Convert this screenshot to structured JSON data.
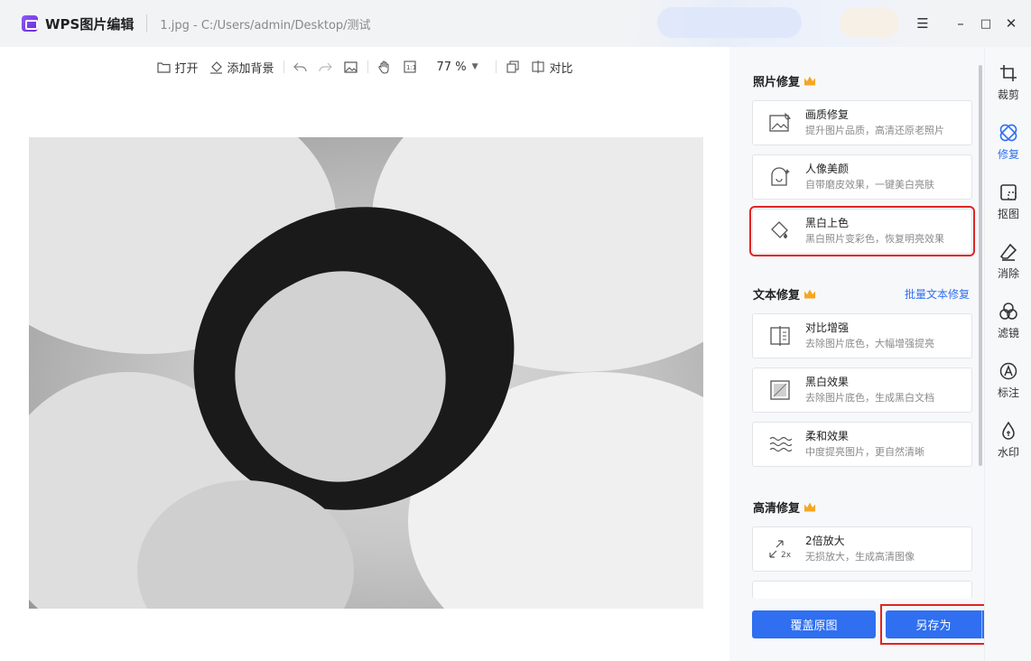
{
  "app": {
    "name": "WPS图片编辑",
    "file_path": "1.jpg - C:/Users/admin/Desktop/测试"
  },
  "window_controls": {
    "menu": "☰",
    "minimize": "–",
    "maximize": "□",
    "close": "✕"
  },
  "toolbar": {
    "open_label": "打开",
    "add_bg_label": "添加背景",
    "zoom_value": "77 %",
    "compare_label": "对比"
  },
  "panel": {
    "photo_repair": {
      "title": "照片修复",
      "items": [
        {
          "title": "画质修复",
          "desc": "提升图片品质，高清还原老照片",
          "icon": "image-quality-icon"
        },
        {
          "title": "人像美颜",
          "desc": "自带磨皮效果，一键美白亮肤",
          "icon": "portrait-beauty-icon"
        },
        {
          "title": "黑白上色",
          "desc": "黑白照片变彩色，恢复明亮效果",
          "icon": "colorize-icon",
          "selected": true
        }
      ]
    },
    "text_repair": {
      "title": "文本修复",
      "batch_link": "批量文本修复",
      "items": [
        {
          "title": "对比增强",
          "desc": "去除图片底色，大幅增强提亮",
          "icon": "contrast-enhance-icon"
        },
        {
          "title": "黑白效果",
          "desc": "去除图片底色，生成黑白文档",
          "icon": "bw-effect-icon"
        },
        {
          "title": "柔和效果",
          "desc": "中度提亮图片，更自然清晰",
          "icon": "soft-effect-icon"
        }
      ]
    },
    "hd_repair": {
      "title": "高清修复",
      "items": [
        {
          "title": "2倍放大",
          "desc": "无损放大，生成高清图像",
          "icon": "upscale-2x-icon"
        }
      ]
    },
    "overwrite_label": "覆盖原图",
    "saveas_label": "另存为"
  },
  "rail": [
    {
      "label": "裁剪",
      "icon": "crop-icon"
    },
    {
      "label": "修复",
      "icon": "repair-icon",
      "active": true
    },
    {
      "label": "抠图",
      "icon": "cutout-icon"
    },
    {
      "label": "消除",
      "icon": "eraser-icon"
    },
    {
      "label": "滤镜",
      "icon": "filter-icon"
    },
    {
      "label": "标注",
      "icon": "annotate-icon"
    },
    {
      "label": "水印",
      "icon": "watermark-icon"
    }
  ],
  "colors": {
    "accent": "#2f6ff0",
    "highlight": "#e02424",
    "crown": "#f5a623"
  }
}
